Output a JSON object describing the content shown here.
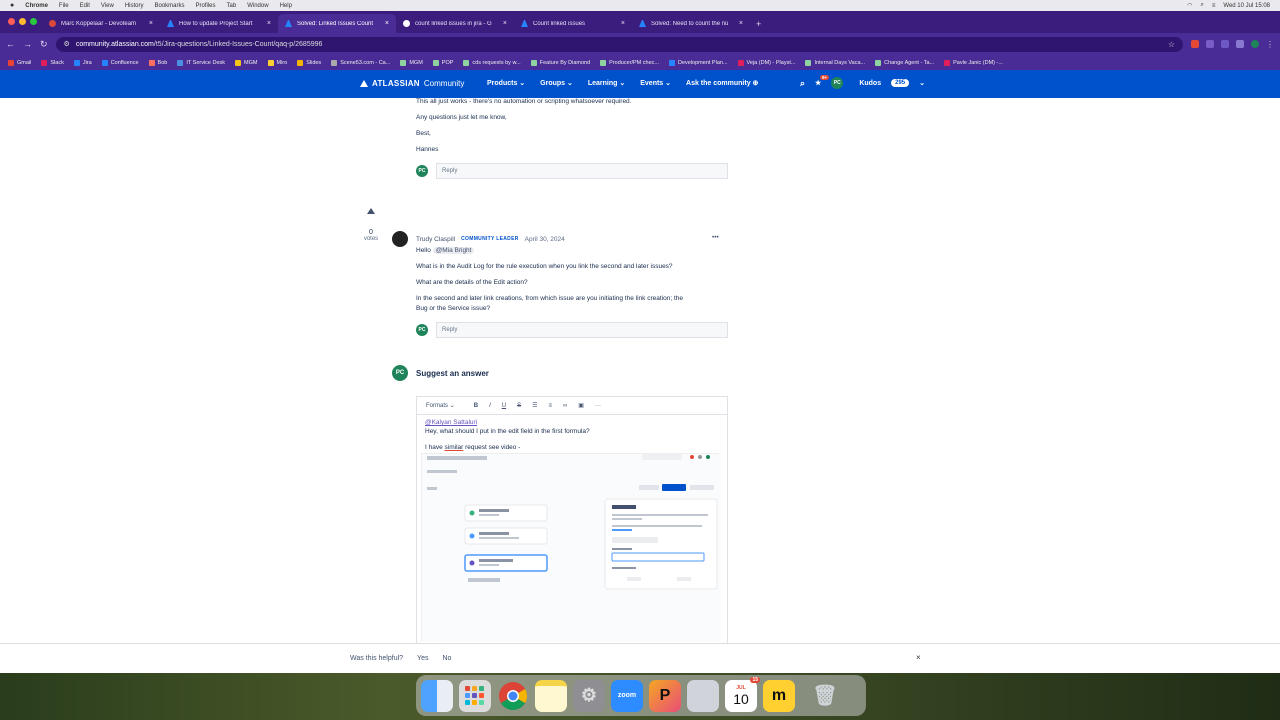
{
  "menubar": {
    "app": "Chrome",
    "items": [
      "File",
      "Edit",
      "View",
      "History",
      "Bookmarks",
      "Profiles",
      "Tab",
      "Window",
      "Help"
    ],
    "clock": "Wed 10 Jul  15:08"
  },
  "tabs": [
    {
      "label": "Marc Koppelaar - Devoteam",
      "favicon_color": "#d9483b"
    },
    {
      "label": "How to update Project Start",
      "favicon_color": "#2684ff"
    },
    {
      "label": "Solved: Linked Issues Count",
      "favicon_color": "#2684ff",
      "active": true
    },
    {
      "label": "count linked issues in jira - G",
      "favicon_color": "#ffffff"
    },
    {
      "label": "Count linked issues",
      "favicon_color": "#2684ff"
    },
    {
      "label": "Solved: Need to count the nu",
      "favicon_color": "#2684ff"
    }
  ],
  "address": {
    "host": "community.atlassian.com",
    "path": "/t5/Jira-questions/Linked-Issues-Count/qaq-p/2685996"
  },
  "bookmarks": [
    "Gmail",
    "Slack",
    "Jira",
    "Confluence",
    "Bob",
    "IT Service Desk",
    "MGM",
    "Miro",
    "Slides",
    "Scene53.com - Ca...",
    "MGM",
    "POP",
    "cds requests by w...",
    "Feature By Diamond",
    "Producer/PM chec...",
    "Development Plan...",
    "Veja (DM) - Playst...",
    "Internal Days Vaca...",
    "Change Agent - Ta...",
    "Pavle Janic (DM) -..."
  ],
  "nav": {
    "logo": "ATLASSIAN",
    "logo_sub": "Community",
    "items": [
      "Products",
      "Groups",
      "Learning",
      "Events"
    ],
    "ask": "Ask the community",
    "notif_count": "9+",
    "avatar": "PC",
    "kudos_label": "Kudos",
    "kudos_count": "295"
  },
  "post1": {
    "line1": "This all just works - there's no automation or scripting whatsoever required.",
    "line2": "Any questions just let me know,",
    "line3": "Best,",
    "line4": "Hannes",
    "reply": "Reply"
  },
  "post2": {
    "votes": "0",
    "votes_label": "votes",
    "author": "Trudy Claspill",
    "role": "COMMUNITY LEADER",
    "date": "April 30, 2024",
    "greeting": "Hello",
    "mention": "@Mia Bright",
    "q1": "What is in the Audit Log for the rule execution when you link the second and later issues?",
    "q2": "What are the details of the Edit action?",
    "q3a": "In the second and later link creations, from which issue are you initiating the link creation; the",
    "q3b": "Bug or the Service issue?",
    "reply": "Reply",
    "more": "•••"
  },
  "suggest": {
    "avatar": "PC",
    "title": "Suggest an answer",
    "toolbar": {
      "formats": "Formats",
      "bold": "B",
      "italic": "I",
      "underline": "U",
      "strike": "S",
      "bullets": "☰",
      "numbers": "≡",
      "link": "🔗",
      "image": "▣",
      "more": "···"
    },
    "mention": "@Kalyan Sattaluri",
    "line1": "Hey, what should I put in the edit field in the first formula?",
    "line2a": "I have ",
    "line2b": "similar",
    "line2c": " request see video -"
  },
  "help": {
    "question": "Was this helpful?",
    "yes": "Yes",
    "no": "No",
    "close": "×"
  },
  "dock": {
    "apps": [
      {
        "name": "finder",
        "color": "#3a7bd5",
        "label": ""
      },
      {
        "name": "launchpad",
        "color": "#e8e8e8",
        "label": ""
      },
      {
        "name": "chrome",
        "color": "#ffffff",
        "label": ""
      },
      {
        "name": "notes",
        "color": "#fcf1a8",
        "label": ""
      },
      {
        "name": "system-settings",
        "color": "#8e8e93",
        "label": ""
      },
      {
        "name": "zoom",
        "color": "#2d8cff",
        "label": "zoom"
      },
      {
        "name": "pycharm",
        "color": "#f5a623",
        "label": ""
      },
      {
        "name": "preview",
        "color": "#d0d4da",
        "label": ""
      },
      {
        "name": "calendar",
        "color": "#ffffff",
        "label": "10"
      },
      {
        "name": "miro",
        "color": "#ffd02f",
        "label": ""
      },
      {
        "name": "trash",
        "color": "#cfd4d9",
        "label": ""
      }
    ],
    "calendar_month": "JUL",
    "calendar_badge": "15"
  }
}
